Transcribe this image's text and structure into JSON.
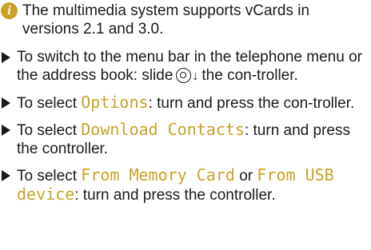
{
  "info": {
    "icon": "info-icon",
    "icon_glyph": "i",
    "icon_color": "#c9a227",
    "text": "The multimedia system supports vCards in versions 2.1 and 3.0."
  },
  "accent_color": "#c9a227",
  "steps": [
    {
      "before": "To switch to the menu bar in the telephone menu or the address book: slide",
      "icons": [
        "controller-icon",
        "down-arrow-icon"
      ],
      "arrow": "↓",
      "after": "the con-troller."
    },
    {
      "before": "To select ",
      "term": "Options",
      "after": ": turn and press the con-troller."
    },
    {
      "before": "To select ",
      "term": "Download Contacts",
      "after": ": turn and press the controller."
    },
    {
      "before": "To select ",
      "term1": "From Memory Card",
      "middle": " or ",
      "term2": "From USB device",
      "after": ": turn and press the controller."
    }
  ]
}
